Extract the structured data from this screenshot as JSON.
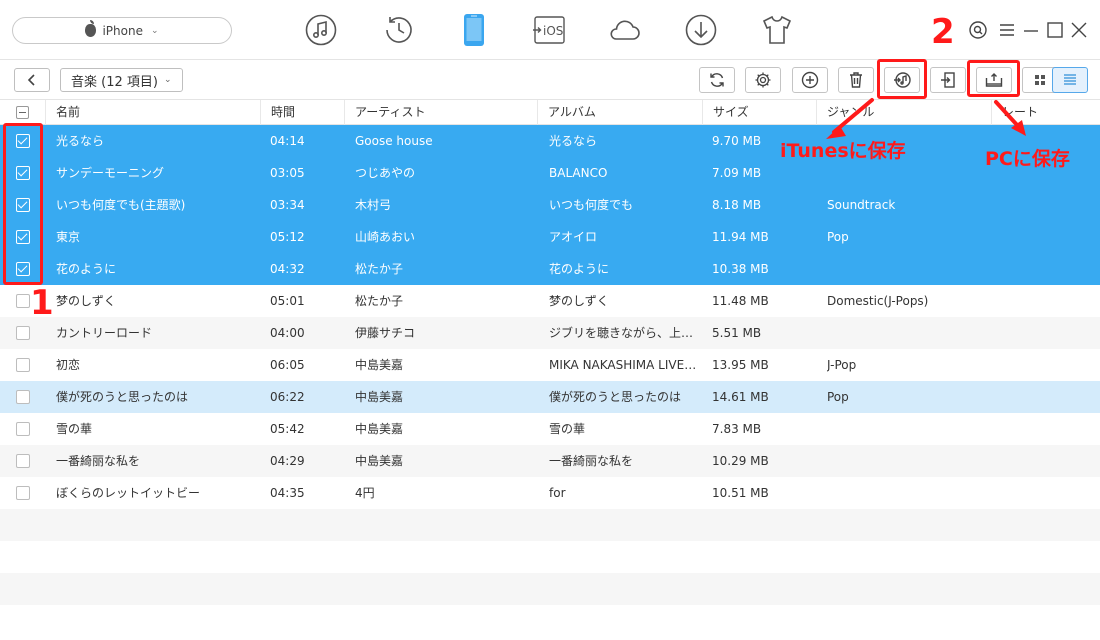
{
  "header": {
    "device_name": "iPhone",
    "nav_icons": [
      "music-icon",
      "history-icon",
      "iphone-icon",
      "to-ios-icon",
      "cloud-icon",
      "download-icon",
      "tshirt-icon"
    ],
    "to_ios_label": "iOS",
    "accent_color": "#38aaf1"
  },
  "toolbar": {
    "category_label": "音楽 (12 項目)",
    "buttons": [
      "refresh-icon",
      "settings-icon",
      "add-icon",
      "delete-icon",
      "to-itunes-icon",
      "import-icon",
      "to-pc-icon",
      "grid-view-icon",
      "list-view-icon"
    ]
  },
  "table": {
    "columns": [
      "名前",
      "時間",
      "アーティスト",
      "アルバム",
      "サイズ",
      "ジャンル",
      "レート"
    ],
    "rows": [
      {
        "checked": true,
        "name": "光るなら",
        "time": "04:14",
        "artist": "Goose house",
        "album": "光るなら",
        "size": "9.70 MB",
        "genre": ""
      },
      {
        "checked": true,
        "name": "サンデーモーニング",
        "time": "03:05",
        "artist": "つじあやの",
        "album": "BALANCO",
        "size": "7.09 MB",
        "genre": ""
      },
      {
        "checked": true,
        "name": "いつも何度でも(主題歌)",
        "time": "03:34",
        "artist": "木村弓",
        "album": "いつも何度でも",
        "size": "8.18 MB",
        "genre": "Soundtrack"
      },
      {
        "checked": true,
        "name": "東京",
        "time": "05:12",
        "artist": "山崎あおい",
        "album": "アオイロ",
        "size": "11.94 MB",
        "genre": "Pop"
      },
      {
        "checked": true,
        "name": "花のように",
        "time": "04:32",
        "artist": "松たか子",
        "album": "花のように",
        "size": "10.38 MB",
        "genre": ""
      },
      {
        "checked": false,
        "name": "梦のしずく",
        "time": "05:01",
        "artist": "松たか子",
        "album": "梦のしずく",
        "size": "11.48 MB",
        "genre": "Domestic(J-Pops)"
      },
      {
        "checked": false,
        "name": "カントリーロード",
        "time": "04:00",
        "artist": "伊藤サチコ",
        "album": "ジブリを聴きながら、上を向い...",
        "size": "5.51 MB",
        "genre": ""
      },
      {
        "checked": false,
        "name": "初恋",
        "time": "06:05",
        "artist": "中島美嘉",
        "album": "MIKA NAKASHIMA LIVE I...",
        "size": "13.95 MB",
        "genre": "J-Pop"
      },
      {
        "checked": false,
        "name": "僕が死のうと思ったのは",
        "time": "06:22",
        "artist": "中島美嘉",
        "album": "僕が死のうと思ったのは",
        "size": "14.61 MB",
        "genre": "Pop"
      },
      {
        "checked": false,
        "name": "雪の華",
        "time": "05:42",
        "artist": "中島美嘉",
        "album": "雪の華",
        "size": "7.83 MB",
        "genre": ""
      },
      {
        "checked": false,
        "name": "一番綺丽な私を",
        "time": "04:29",
        "artist": "中島美嘉",
        "album": "一番綺丽な私を",
        "size": "10.29 MB",
        "genre": ""
      },
      {
        "checked": false,
        "name": "ぼくらのレットイットビー",
        "time": "04:35",
        "artist": "4円",
        "album": "for",
        "size": "10.51 MB",
        "genre": ""
      }
    ]
  },
  "annotations": {
    "step1": "1",
    "step2": "2",
    "itunes_label": "iTunesに保存",
    "pc_label": "PCに保存",
    "highlight_color": "#ff1a1a"
  }
}
